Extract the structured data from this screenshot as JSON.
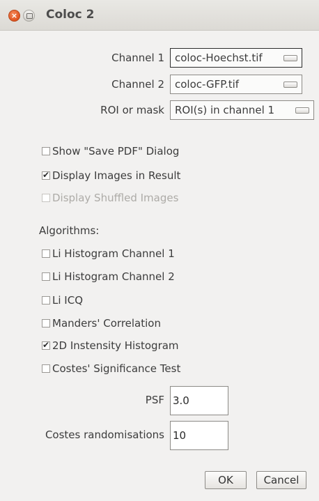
{
  "window": {
    "title": "Coloc 2"
  },
  "channel1": {
    "label": "Channel 1",
    "value": "coloc-Hoechst.tif"
  },
  "channel2": {
    "label": "Channel 2",
    "value": "coloc-GFP.tif"
  },
  "roi": {
    "label": "ROI or mask",
    "value": "ROI(s) in channel 1"
  },
  "options": [
    {
      "label": "Show \"Save PDF\" Dialog",
      "checked": false,
      "enabled": true
    },
    {
      "label": "Display Images in Result",
      "checked": true,
      "enabled": true
    },
    {
      "label": "Display Shuffled Images",
      "checked": false,
      "enabled": false
    }
  ],
  "algorithms": {
    "heading": "Algorithms:",
    "items": [
      {
        "label": "Li Histogram Channel 1",
        "checked": false
      },
      {
        "label": "Li Histogram Channel 2",
        "checked": false
      },
      {
        "label": "Li ICQ",
        "checked": false
      },
      {
        "label": "Manders' Correlation",
        "checked": false
      },
      {
        "label": "2D Instensity Histogram",
        "checked": true
      },
      {
        "label": "Costes' Significance Test",
        "checked": false
      }
    ]
  },
  "psf": {
    "label": "PSF",
    "value": "3.0"
  },
  "costes": {
    "label": "Costes randomisations",
    "value": "10"
  },
  "buttons": {
    "ok": "OK",
    "cancel": "Cancel"
  },
  "colors": {
    "close_button": "#e05420",
    "background": "#f2f1f0"
  },
  "icons": [
    "close-icon",
    "maximize-icon",
    "dropdown-arrow-icon",
    "checkmark-icon"
  ]
}
